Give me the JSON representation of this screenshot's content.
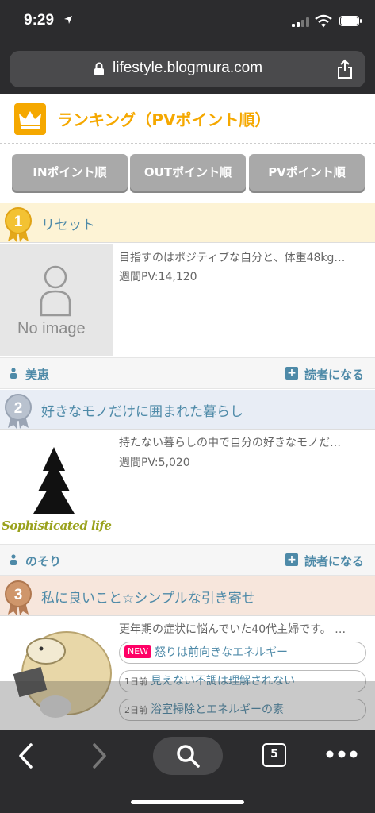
{
  "status": {
    "time": "9:29"
  },
  "browser": {
    "url": "lifestyle.blogmura.com",
    "tab_count": "5"
  },
  "page": {
    "title": "ランキング（PVポイント順）",
    "sort_buttons": [
      "INポイント順",
      "OUTポイント順",
      "PVポイント順"
    ]
  },
  "rankings": [
    {
      "rank": "1",
      "blog_name": "リセット",
      "thumbnail_text": "No image",
      "description": "目指すのはポジティブな自分と、体重48kg…",
      "pv": "週間PV:14,120",
      "author": "美恵",
      "follow_label": "読者になる"
    },
    {
      "rank": "2",
      "blog_name": "好きなモノだけに囲まれた暮らし",
      "thumbnail_text": "Sophisticated life",
      "description": "持たない暮らしの中で自分の好きなモノだ…",
      "pv": "週間PV:5,020",
      "author": "のそり",
      "follow_label": "読者になる"
    },
    {
      "rank": "3",
      "blog_name": "私に良いこと☆シンプルな引き寄せ",
      "description": "更年期の症状に悩んでいた40代主婦です。 …",
      "entries": [
        {
          "tag": "NEW",
          "title": "怒りは前向きなエネルギー"
        },
        {
          "tag": "1日前",
          "title": "見えない不調は理解されない"
        },
        {
          "tag": "2日前",
          "title": "浴室掃除とエネルギーの素"
        }
      ]
    }
  ],
  "colors": {
    "accent": "#f5a800",
    "link": "#4e8aa8",
    "gold_bg": "#fdf3d5",
    "silver_bg": "#e8edf5",
    "bronze_bg": "#f7e6dc"
  },
  "icons": [
    "location-arrow-icon",
    "signal-icon",
    "wifi-icon",
    "battery-icon",
    "lock-icon",
    "share-icon",
    "crown-icon",
    "medal-icon",
    "person-icon",
    "plus-icon",
    "back-icon",
    "forward-icon",
    "search-icon",
    "tabs-icon",
    "more-icon"
  ]
}
